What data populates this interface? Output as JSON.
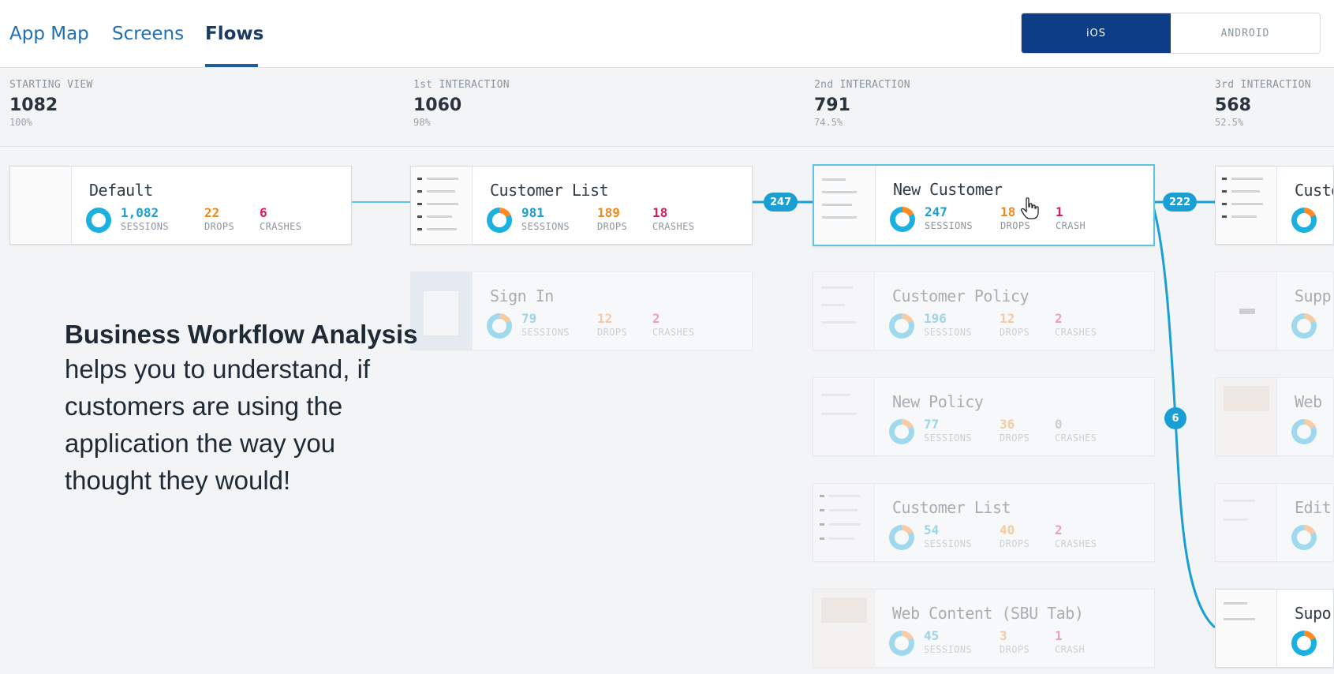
{
  "nav": {
    "tabs": [
      {
        "label": "App Map"
      },
      {
        "label": "Screens"
      },
      {
        "label": "Flows"
      }
    ],
    "active_tab": "Flows"
  },
  "platform": {
    "ios": "iOS",
    "android": "ANDROID",
    "active": "iOS"
  },
  "stages": [
    {
      "label": "STARTING VIEW",
      "count": "1082",
      "pct": "100%"
    },
    {
      "label": "1st INTERACTION",
      "count": "1060",
      "pct": "98%"
    },
    {
      "label": "2nd INTERACTION",
      "count": "791",
      "pct": "74.5%"
    },
    {
      "label": "3rd INTERACTION",
      "count": "568",
      "pct": "52.5%"
    }
  ],
  "stat_labels": {
    "sessions": "SESSIONS",
    "drops": "DROPS",
    "crashes": "CRASHES",
    "crash": "CRASH"
  },
  "cards": {
    "default": {
      "title": "Default",
      "sessions": "1,082",
      "drops": "22",
      "crashes": "6"
    },
    "customer_list_1": {
      "title": "Customer List",
      "sessions": "981",
      "drops": "189",
      "crashes": "18"
    },
    "sign_in": {
      "title": "Sign In",
      "sessions": "79",
      "drops": "12",
      "crashes": "2"
    },
    "new_customer": {
      "title": "New Customer",
      "sessions": "247",
      "drops": "18",
      "crashes": "1"
    },
    "customer_policy": {
      "title": "Customer Policy",
      "sessions": "196",
      "drops": "12",
      "crashes": "2"
    },
    "new_policy": {
      "title": "New Policy",
      "sessions": "77",
      "drops": "36",
      "crashes": "0"
    },
    "customer_list_2": {
      "title": "Customer List",
      "sessions": "54",
      "drops": "40",
      "crashes": "2"
    },
    "web_content": {
      "title": "Web Content (SBU Tab)",
      "sessions": "45",
      "drops": "3",
      "crashes": "1"
    },
    "col3_a": {
      "title": "Custo"
    },
    "col3_b": {
      "title": "Supp"
    },
    "col3_c": {
      "title": "Web"
    },
    "col3_d": {
      "title": "Edit"
    },
    "col3_e": {
      "title": "Supo"
    }
  },
  "links": {
    "badge_247": "247",
    "badge_222": "222",
    "badge_6": "6"
  },
  "overlay": {
    "title": "Business Workflow Analysis",
    "body": "helps you to understand, if\ncustomers are using the\napplication the way you\nthought they would!"
  },
  "colors": {
    "sessions": "#1a9fd4",
    "drops": "#f08a1e",
    "crashes": "#d81b60",
    "accent": "#0c3d86"
  }
}
